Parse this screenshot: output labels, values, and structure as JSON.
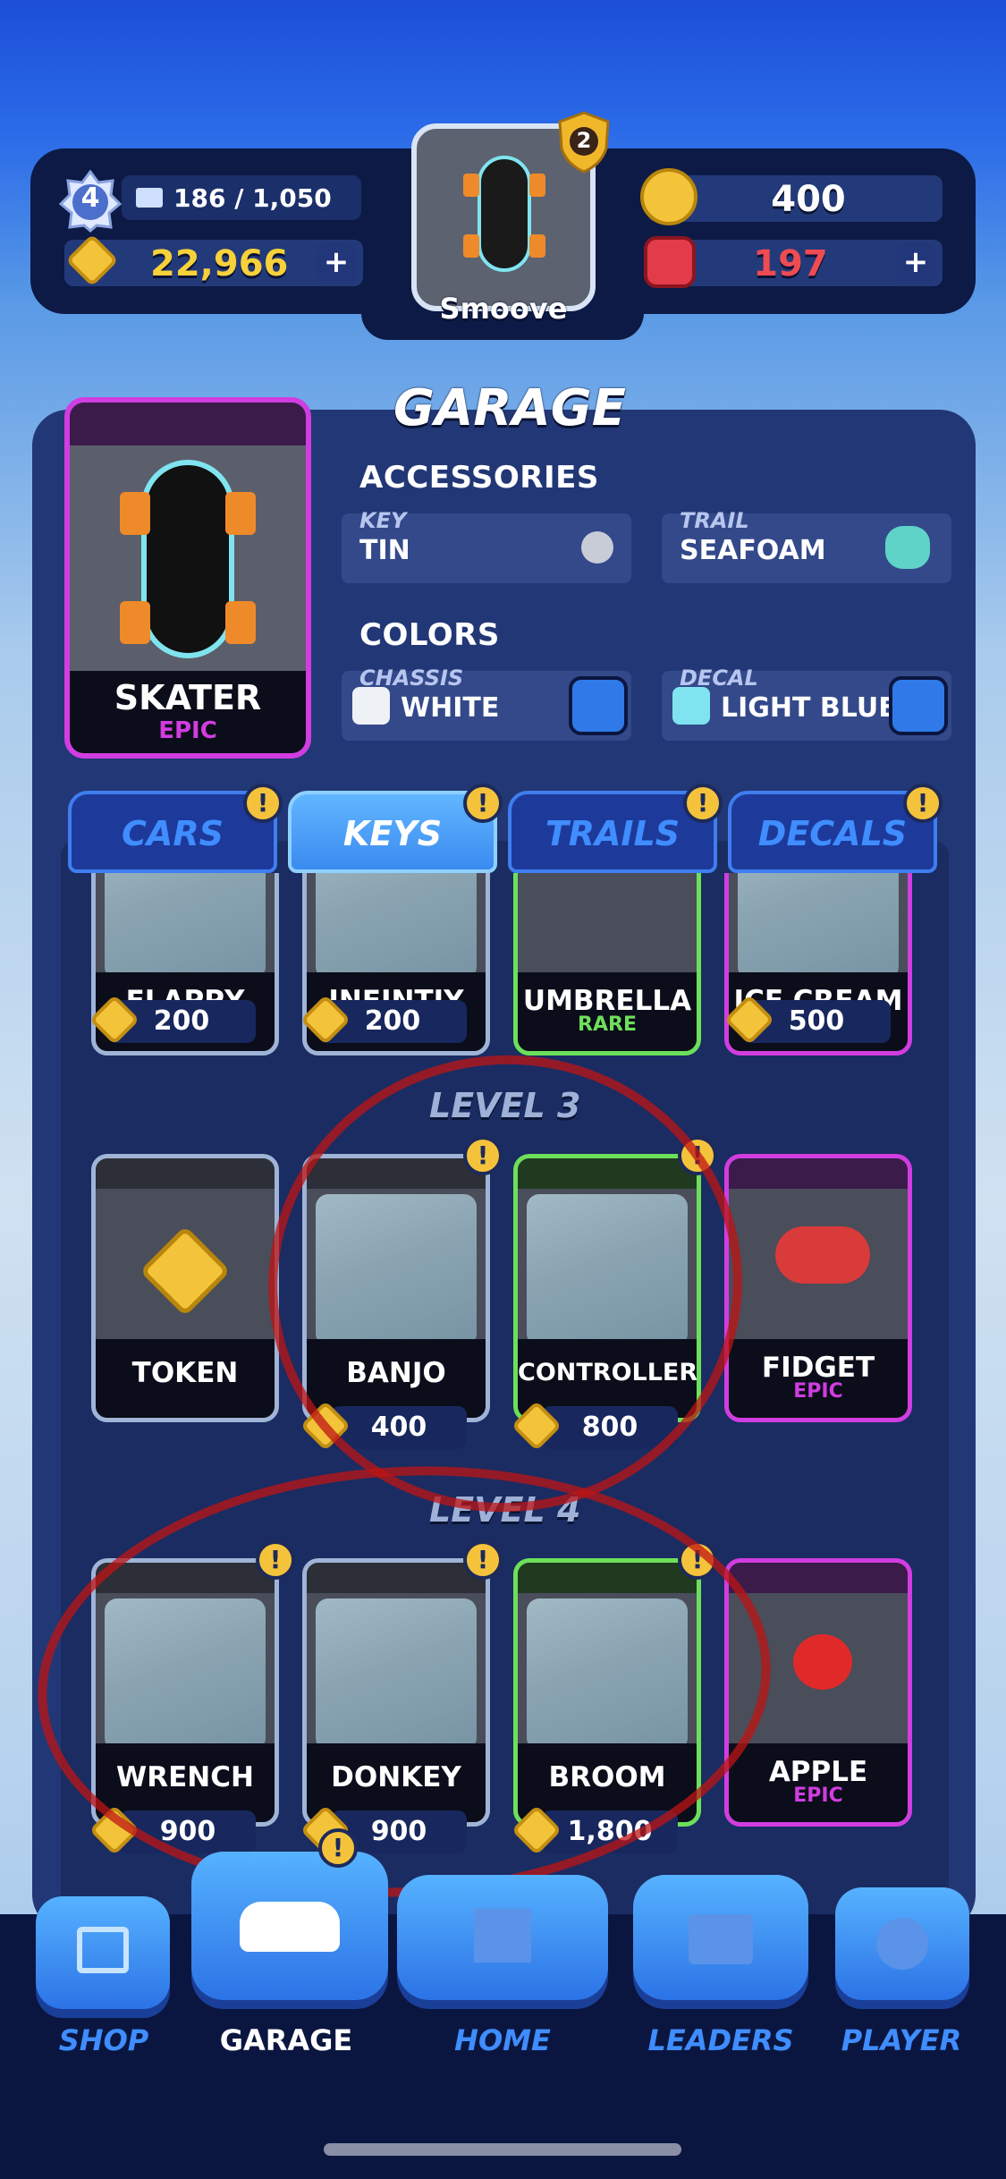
{
  "top_bar": {
    "level": "4",
    "xp": "186 / 1,050",
    "coins": "22,966",
    "gold": "400",
    "gems": "197",
    "car_name": "Smoove",
    "car_badge": "2"
  },
  "garage": {
    "title": "GARAGE",
    "card_name": "SKATER",
    "card_rarity": "EPIC",
    "accessories_title": "ACCESSORIES",
    "key_label": "KEY",
    "key_value": "TIN",
    "trail_label": "TRAIL",
    "trail_value": "SEAFOAM",
    "colors_title": "COLORS",
    "chassis_label": "CHASSIS",
    "chassis_value": "WHITE",
    "decal_label": "DECAL",
    "decal_value": "LIGHT BLUE"
  },
  "tabs": [
    {
      "label": "CARS"
    },
    {
      "label": "KEYS"
    },
    {
      "label": "TRAILS"
    },
    {
      "label": "DECALS"
    }
  ],
  "row1": [
    {
      "name": "FLAPPY",
      "price": "200"
    },
    {
      "name": "INFINTIY",
      "price": "200"
    },
    {
      "name": "UMBRELLA",
      "rarity": "RARE"
    },
    {
      "name": "ICE CREAM",
      "price": "500"
    }
  ],
  "level3_title": "LEVEL 3",
  "row2": [
    {
      "name": "TOKEN"
    },
    {
      "name": "BANJO",
      "price": "400"
    },
    {
      "name": "CONTROLLER",
      "price": "800"
    },
    {
      "name": "FIDGET",
      "rarity": "EPIC"
    }
  ],
  "level4_title": "LEVEL 4",
  "row3": [
    {
      "name": "WRENCH",
      "price": "900"
    },
    {
      "name": "DONKEY",
      "price": "900"
    },
    {
      "name": "BROOM",
      "price": "1,800"
    },
    {
      "name": "APPLE",
      "rarity": "EPIC"
    }
  ],
  "nav": {
    "shop": "SHOP",
    "garage": "GARAGE",
    "home": "HOME",
    "leaders": "LEADERS",
    "player": "PLAYER"
  },
  "colors": {
    "epic": "#d13de0",
    "rare": "#6de05a",
    "accent": "#3f8dff",
    "badge": "#f5c33b"
  }
}
